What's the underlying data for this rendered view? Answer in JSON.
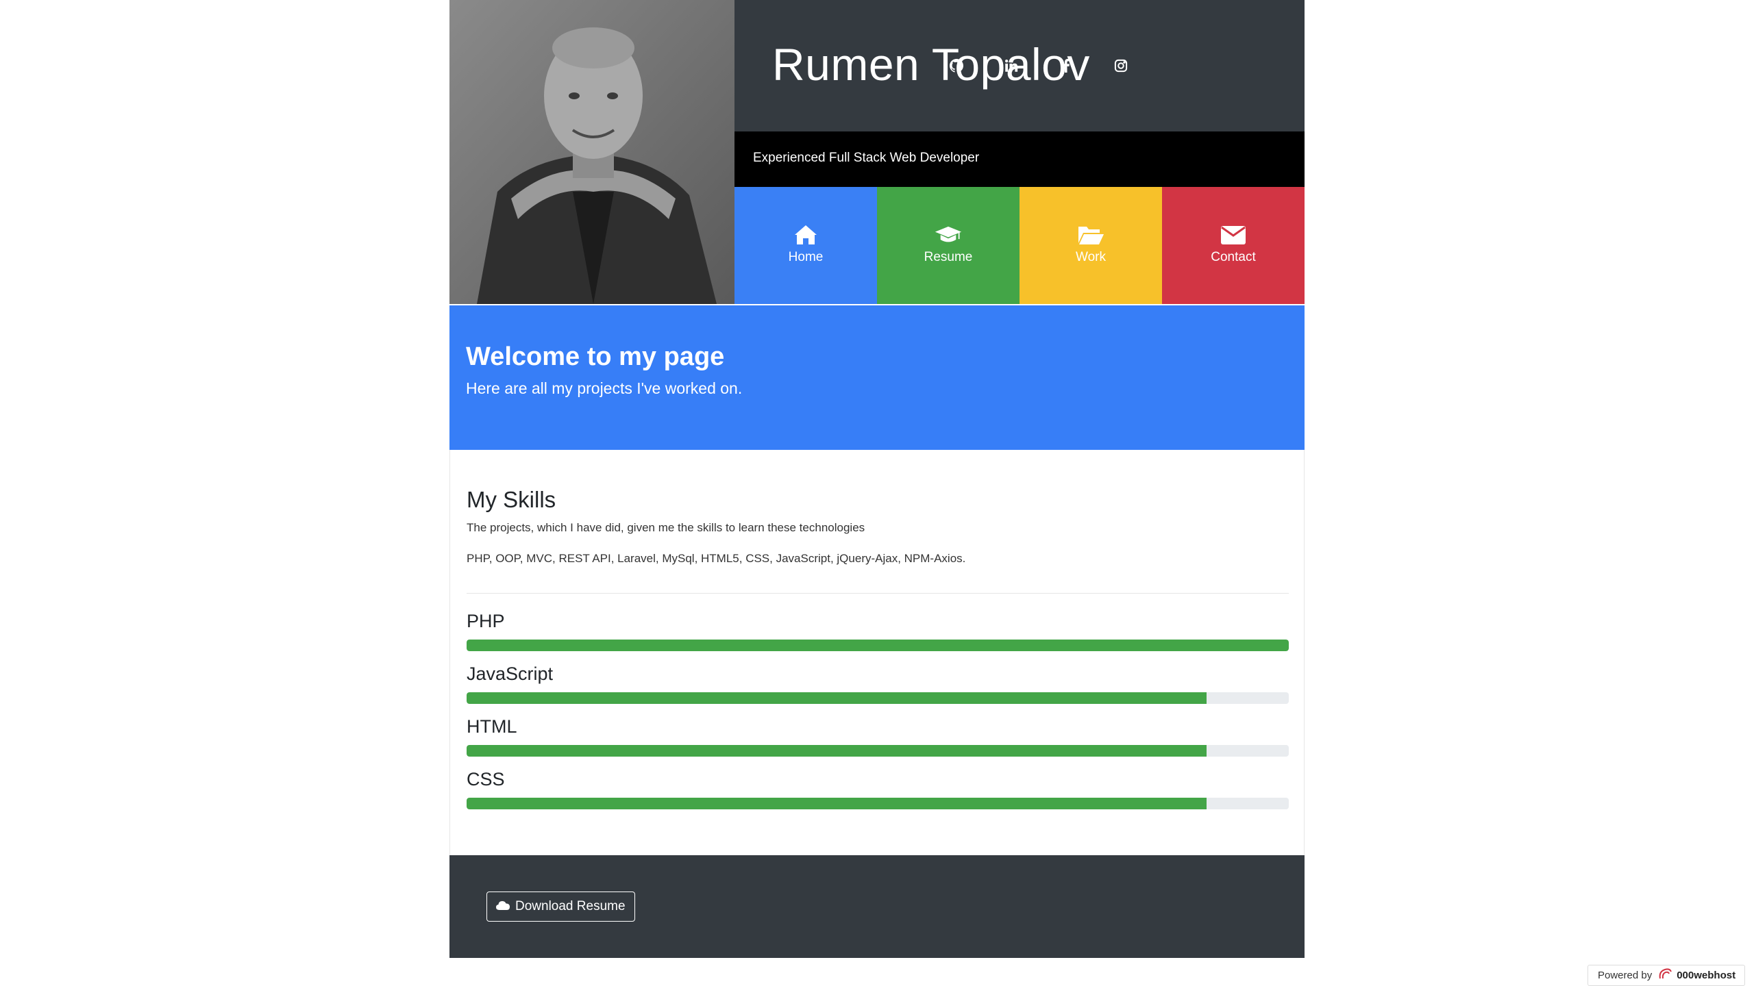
{
  "header": {
    "name": "Rumen Topalov",
    "tagline": "Experienced Full Stack Web Developer",
    "social": [
      "github-icon",
      "linkedin-icon",
      "facebook-icon",
      "instagram-icon"
    ]
  },
  "nav": [
    {
      "label": "Home",
      "icon": "home-icon",
      "color": "#3a80f5"
    },
    {
      "label": "Resume",
      "icon": "graduation-cap-icon",
      "color": "#43a547"
    },
    {
      "label": "Work",
      "icon": "folder-open-icon",
      "color": "#f7c12a"
    },
    {
      "label": "Contact",
      "icon": "envelope-icon",
      "color": "#d23544"
    }
  ],
  "welcome": {
    "title": "Welcome to my page",
    "subtitle": "Here are all my projects I've worked on."
  },
  "skills": {
    "title": "My Skills",
    "subtitle": "The projects, which I have did, given me the skills to learn these technologies",
    "technologies": "PHP, OOP, MVC, REST API, Laravel, MySql, HTML5, CSS, JavaScript, jQuery-Ajax, NPM-Axios.",
    "items": [
      {
        "name": "PHP",
        "level": 1.0
      },
      {
        "name": "JavaScript",
        "level": 0.9
      },
      {
        "name": "HTML",
        "level": 0.9
      },
      {
        "name": "CSS",
        "level": 0.9
      }
    ]
  },
  "footer": {
    "download_label": "Download Resume",
    "download_icon": "cloud-icon"
  },
  "powered": {
    "prefix": "Powered by",
    "brand": "000webhost"
  },
  "colors": {
    "accent_blue": "#377ef7",
    "success_green": "#43a547",
    "dark": "#343a40"
  }
}
